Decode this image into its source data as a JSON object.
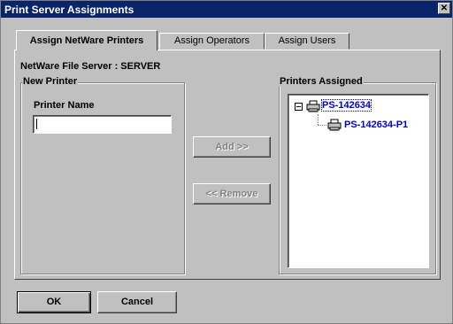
{
  "window": {
    "title": "Print Server Assignments",
    "close_glyph": "✕"
  },
  "tabs": [
    {
      "label": "Assign NetWare Printers",
      "active": true
    },
    {
      "label": "Assign Operators",
      "active": false
    },
    {
      "label": "Assign Users",
      "active": false
    }
  ],
  "server_label": "NetWare File Server : SERVER",
  "new_printer": {
    "group_label": "New Printer",
    "name_label": "Printer Name",
    "name_value": ""
  },
  "buttons": {
    "add": "Add >>",
    "remove": "<< Remove",
    "ok": "OK",
    "cancel": "Cancel"
  },
  "assigned": {
    "group_label": "Printers Assigned",
    "tree": [
      {
        "label": "PS-142634",
        "icon": "printer-server-icon",
        "expanded": true,
        "selected": true
      },
      {
        "label": "PS-142634-P1",
        "icon": "printer-icon",
        "level": 1
      }
    ]
  },
  "colors": {
    "titlebar": "#0a246a",
    "tree_text": "#0000cc",
    "face": "#c0c0c0"
  }
}
